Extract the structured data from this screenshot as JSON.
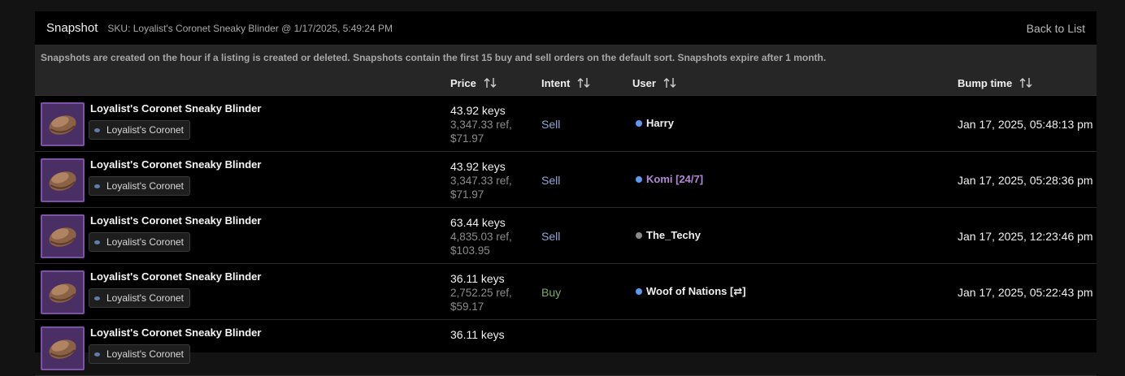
{
  "header": {
    "title": "Snapshot",
    "sku": "SKU: Loyalist's Coronet Sneaky Blinder @ 1/17/2025, 5:49:24 PM",
    "back_label": "Back to List"
  },
  "notice": "Snapshots are created on the hour if a listing is created or deleted. Snapshots contain the first 15 buy and sell orders on the default sort. Snapshots expire after 1 month.",
  "columns": {
    "price": "Price",
    "intent": "Intent",
    "user": "User",
    "bump": "Bump time"
  },
  "colors": {
    "sell": "#8ea9d4",
    "buy": "#7fa860",
    "status_online": "#5b9bf0",
    "status_offline": "#8a8a8a",
    "user_default": "#f0f0f0",
    "user_premium": "#b487d9"
  },
  "rows": [
    {
      "item_name": "Loyalist's Coronet Sneaky Blinder",
      "tag": "Loyalist's Coronet",
      "price_keys": "43.92 keys",
      "price_ref": "3,347.33 ref,",
      "price_usd": "$71.97",
      "intent": "Sell",
      "user": "Harry",
      "bump": "Jan 17, 2025, 05:48:13 pm"
    },
    {
      "item_name": "Loyalist's Coronet Sneaky Blinder",
      "tag": "Loyalist's Coronet",
      "price_keys": "43.92 keys",
      "price_ref": "3,347.33 ref,",
      "price_usd": "$71.97",
      "intent": "Sell",
      "user": "Komi [24/7]",
      "bump": "Jan 17, 2025, 05:28:36 pm"
    },
    {
      "item_name": "Loyalist's Coronet Sneaky Blinder",
      "tag": "Loyalist's Coronet",
      "price_keys": "63.44 keys",
      "price_ref": "4,835.03 ref,",
      "price_usd": "$103.95",
      "intent": "Sell",
      "user": "The_Techy",
      "bump": "Jan 17, 2025, 12:23:46 pm"
    },
    {
      "item_name": "Loyalist's Coronet Sneaky Blinder",
      "tag": "Loyalist's Coronet",
      "price_keys": "36.11 keys",
      "price_ref": "2,752.25 ref,",
      "price_usd": "$59.17",
      "intent": "Buy",
      "user": "Woof of Nations [⇄]",
      "bump": "Jan 17, 2025, 05:22:43 pm"
    },
    {
      "item_name": "Loyalist's Coronet Sneaky Blinder",
      "tag": "Loyalist's Coronet",
      "price_keys": "36.11 keys",
      "price_ref": "",
      "price_usd": "",
      "intent": "",
      "user": "",
      "bump": ""
    }
  ]
}
